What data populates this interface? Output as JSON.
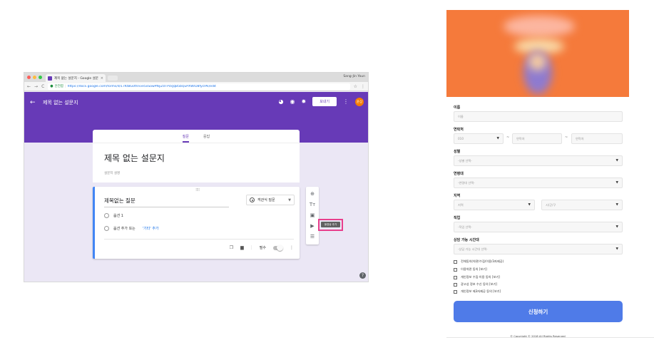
{
  "browser": {
    "tab_title": "제목 없는 설문지 - Google 설문지",
    "tab_close": "×",
    "user": "Sang-Jin Youn",
    "secure_label": "안전함",
    "url": "https://docs.google.com/forms/d/17KtBG0tVvve5xSowPNyZ0TPckJqB5bQuPXWrD8fycIPk/edit",
    "nav_back": "←",
    "nav_forward": "→",
    "nav_reload": "C",
    "star": "☆",
    "menu": "⋮"
  },
  "forms": {
    "header_title": "제목 없는 설문지",
    "send_label": "보내기",
    "avatar_text": "윤상",
    "tabs": [
      "질문",
      "응답"
    ],
    "title": "제목 없는 설문지",
    "description_placeholder": "설문지 설명",
    "question": {
      "title": "제목없는 질문",
      "type": "객관식 질문",
      "option1": "옵션 1",
      "add_option": "옵션 추가 또는",
      "add_other": "'기타' 추가",
      "required_label": "필수"
    },
    "tooltip": "동영상 추가",
    "help": "?"
  },
  "signup": {
    "fields": {
      "name": {
        "label": "이름",
        "placeholder": "이름"
      },
      "phone": {
        "label": "연락처",
        "part1": "010",
        "part2": "연락처",
        "part3": "연락처"
      },
      "gender": {
        "label": "성별",
        "placeholder": "-성별 선택-"
      },
      "age": {
        "label": "연령대",
        "placeholder": "-연령대 선택-"
      },
      "region": {
        "label": "지역",
        "city": "지역",
        "district": "시/군/구"
      },
      "job": {
        "label": "직업",
        "placeholder": "-직업 선택-"
      },
      "time": {
        "label": "상담 가능 시간대",
        "placeholder": "-상담 가능 시간대 선택-"
      }
    },
    "consents": [
      "전체동의(약관/수집/이용/3자제공)",
      "이용약관 동의 [보기]",
      "개인정보 수집·이용 동의 [보기]",
      "광고성 정보 수신 동의 [보기]",
      "개인정보 제3자제공 동의 [보기]"
    ],
    "submit_label": "신청하기",
    "copyright": "© Copyright © 2018 All Rights Reserved"
  },
  "colors": {
    "forms_purple": "#673ab7",
    "banner_orange": "#f57a3b",
    "submit_blue": "#4f7be8",
    "highlight_pink": "#e83e8c"
  }
}
